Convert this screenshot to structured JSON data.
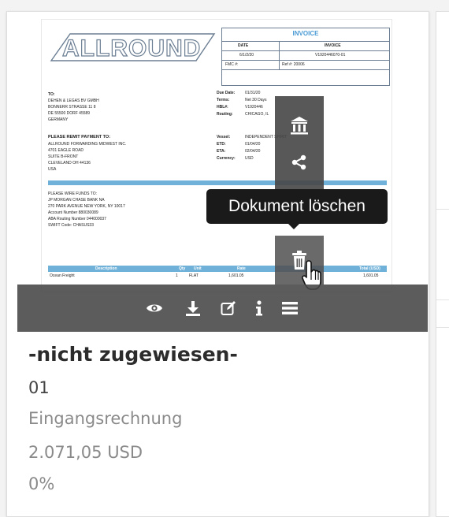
{
  "document_preview": {
    "logo_text": "ALLROUND",
    "invoice_title": "INVOICE",
    "header_cols": [
      "DATE",
      "INVOICE"
    ],
    "header_vals": [
      "6/1/2/20",
      "V1920446070-01"
    ],
    "row3": [
      "FMC #:",
      "Ref #: 20006"
    ],
    "to_label": "TO:",
    "to_lines": [
      "DEHEN & LEGAS BV GMBH",
      "BONNERR STRASSE 11 8",
      "DE 55500 DORF 45589",
      "GERMANY"
    ],
    "right_labels": [
      "Due Date:",
      "Terms:",
      "HBL#:",
      "Routing:"
    ],
    "right_vals": [
      "01/31/20",
      "Net 30 Days",
      "V1920446",
      "CHICAGO, IL"
    ],
    "remit_label": "PLEASE REMIT PAYMENT TO:",
    "remit_lines": [
      "ALLROUND FORWARDING MIDWEST INC.",
      "4701 EAGLE ROAD",
      "SUITE B-FRONT",
      "CLEVELAND OH 44136",
      "USA"
    ],
    "vessel_labels": [
      "Vessel:",
      "ETD:",
      "ETA:",
      "Currency:"
    ],
    "vessel_vals": [
      "INDEPENDENT SPIRIT",
      "01/04/20",
      "02/04/20",
      "USD"
    ],
    "wire_lines": [
      "PLEASE WIRE FUNDS TO:",
      "JP MORGAN CHASE BANK NA",
      "270 PARK AVENUE NEW YORK, NY 10017",
      "Account Number 880030089",
      "ABA Routing Number 044000037",
      "SWIFT Code: CHASUS33"
    ],
    "table_headers": [
      "Description",
      "Qty",
      "Unit",
      "Rate",
      "Total (USD)"
    ],
    "table_row": [
      "Ocean Freight",
      "1",
      "FLAT",
      "1,601.05",
      "1,601.05"
    ]
  },
  "side_menu": {
    "items": [
      {
        "icon": "bank-icon"
      },
      {
        "icon": "share-icon"
      }
    ]
  },
  "tooltip": {
    "text": "Dokument löschen"
  },
  "action_bar": {
    "items": [
      {
        "icon": "eye-icon"
      },
      {
        "icon": "download-icon"
      },
      {
        "icon": "edit-icon"
      },
      {
        "icon": "info-icon"
      },
      {
        "icon": "menu-icon"
      }
    ]
  },
  "document": {
    "title": "-nicht zugewiesen-",
    "number": "01",
    "type": "Eingangsrechnung",
    "amount": "2.071,05 USD",
    "progress": "0%"
  }
}
